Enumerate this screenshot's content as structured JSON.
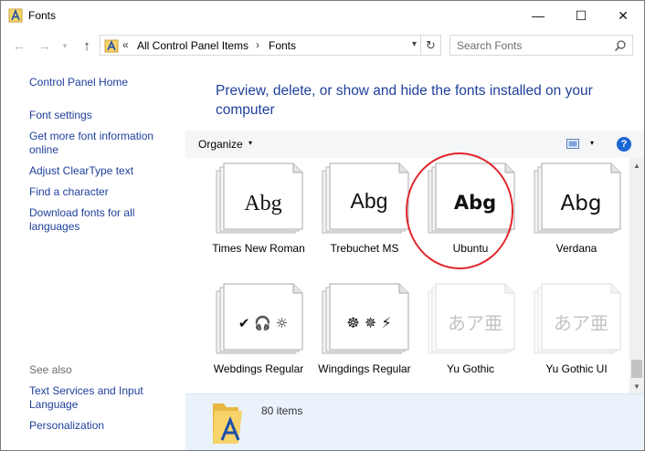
{
  "window": {
    "title": "Fonts",
    "minimize_glyph": "—",
    "maximize_glyph": "☐",
    "close_glyph": "✕"
  },
  "nav": {
    "back_glyph": "←",
    "forward_glyph": "→",
    "history_glyph": "▾",
    "up_glyph": "↑"
  },
  "address": {
    "overflow": "«",
    "crumbs": [
      "All Control Panel Items",
      "Fonts"
    ],
    "separator": "›",
    "dropdown_glyph": "▾",
    "refresh_glyph": "↻"
  },
  "search": {
    "placeholder": "Search Fonts"
  },
  "left_pane": {
    "home_link": "Control Panel Home",
    "links": [
      "Font settings",
      "Get more font information online",
      "Adjust ClearType text",
      "Find a character",
      "Download fonts for all languages"
    ],
    "see_also_label": "See also",
    "see_also_links": [
      "Text Services and Input Language",
      "Personalization"
    ]
  },
  "main": {
    "heading": "Preview, delete, or show and hide the fonts installed on your computer",
    "toolbar": {
      "organize_label": "Organize",
      "caret": "▾",
      "help_glyph": "?"
    },
    "fonts": [
      {
        "name": "Times New Roman",
        "sample": "Abg",
        "faded": false
      },
      {
        "name": "Trebuchet MS",
        "sample": "Abg",
        "faded": false
      },
      {
        "name": "Ubuntu",
        "sample": "Abg",
        "faded": false,
        "highlighted": true
      },
      {
        "name": "Verdana",
        "sample": "Abg",
        "faded": false
      },
      {
        "name": "Webdings Regular",
        "sample": "✔ 🎧 ☼",
        "faded": false
      },
      {
        "name": "Wingdings Regular",
        "sample": "☸ ✵ ⚡",
        "faded": false
      },
      {
        "name": "Yu Gothic",
        "sample": "あア亜",
        "faded": true
      },
      {
        "name": "Yu Gothic UI",
        "sample": "あア亜",
        "faded": true
      }
    ],
    "scroll": {
      "up_glyph": "▲",
      "down_glyph": "▼"
    },
    "details": {
      "item_count": "80 items"
    }
  },
  "colors": {
    "link": "#1e3f9b",
    "toolbar_bg": "#f5f6f7",
    "details_bg": "#eaf2fb",
    "annotation_red": "#e0262b",
    "help_blue": "#1a66d2"
  }
}
